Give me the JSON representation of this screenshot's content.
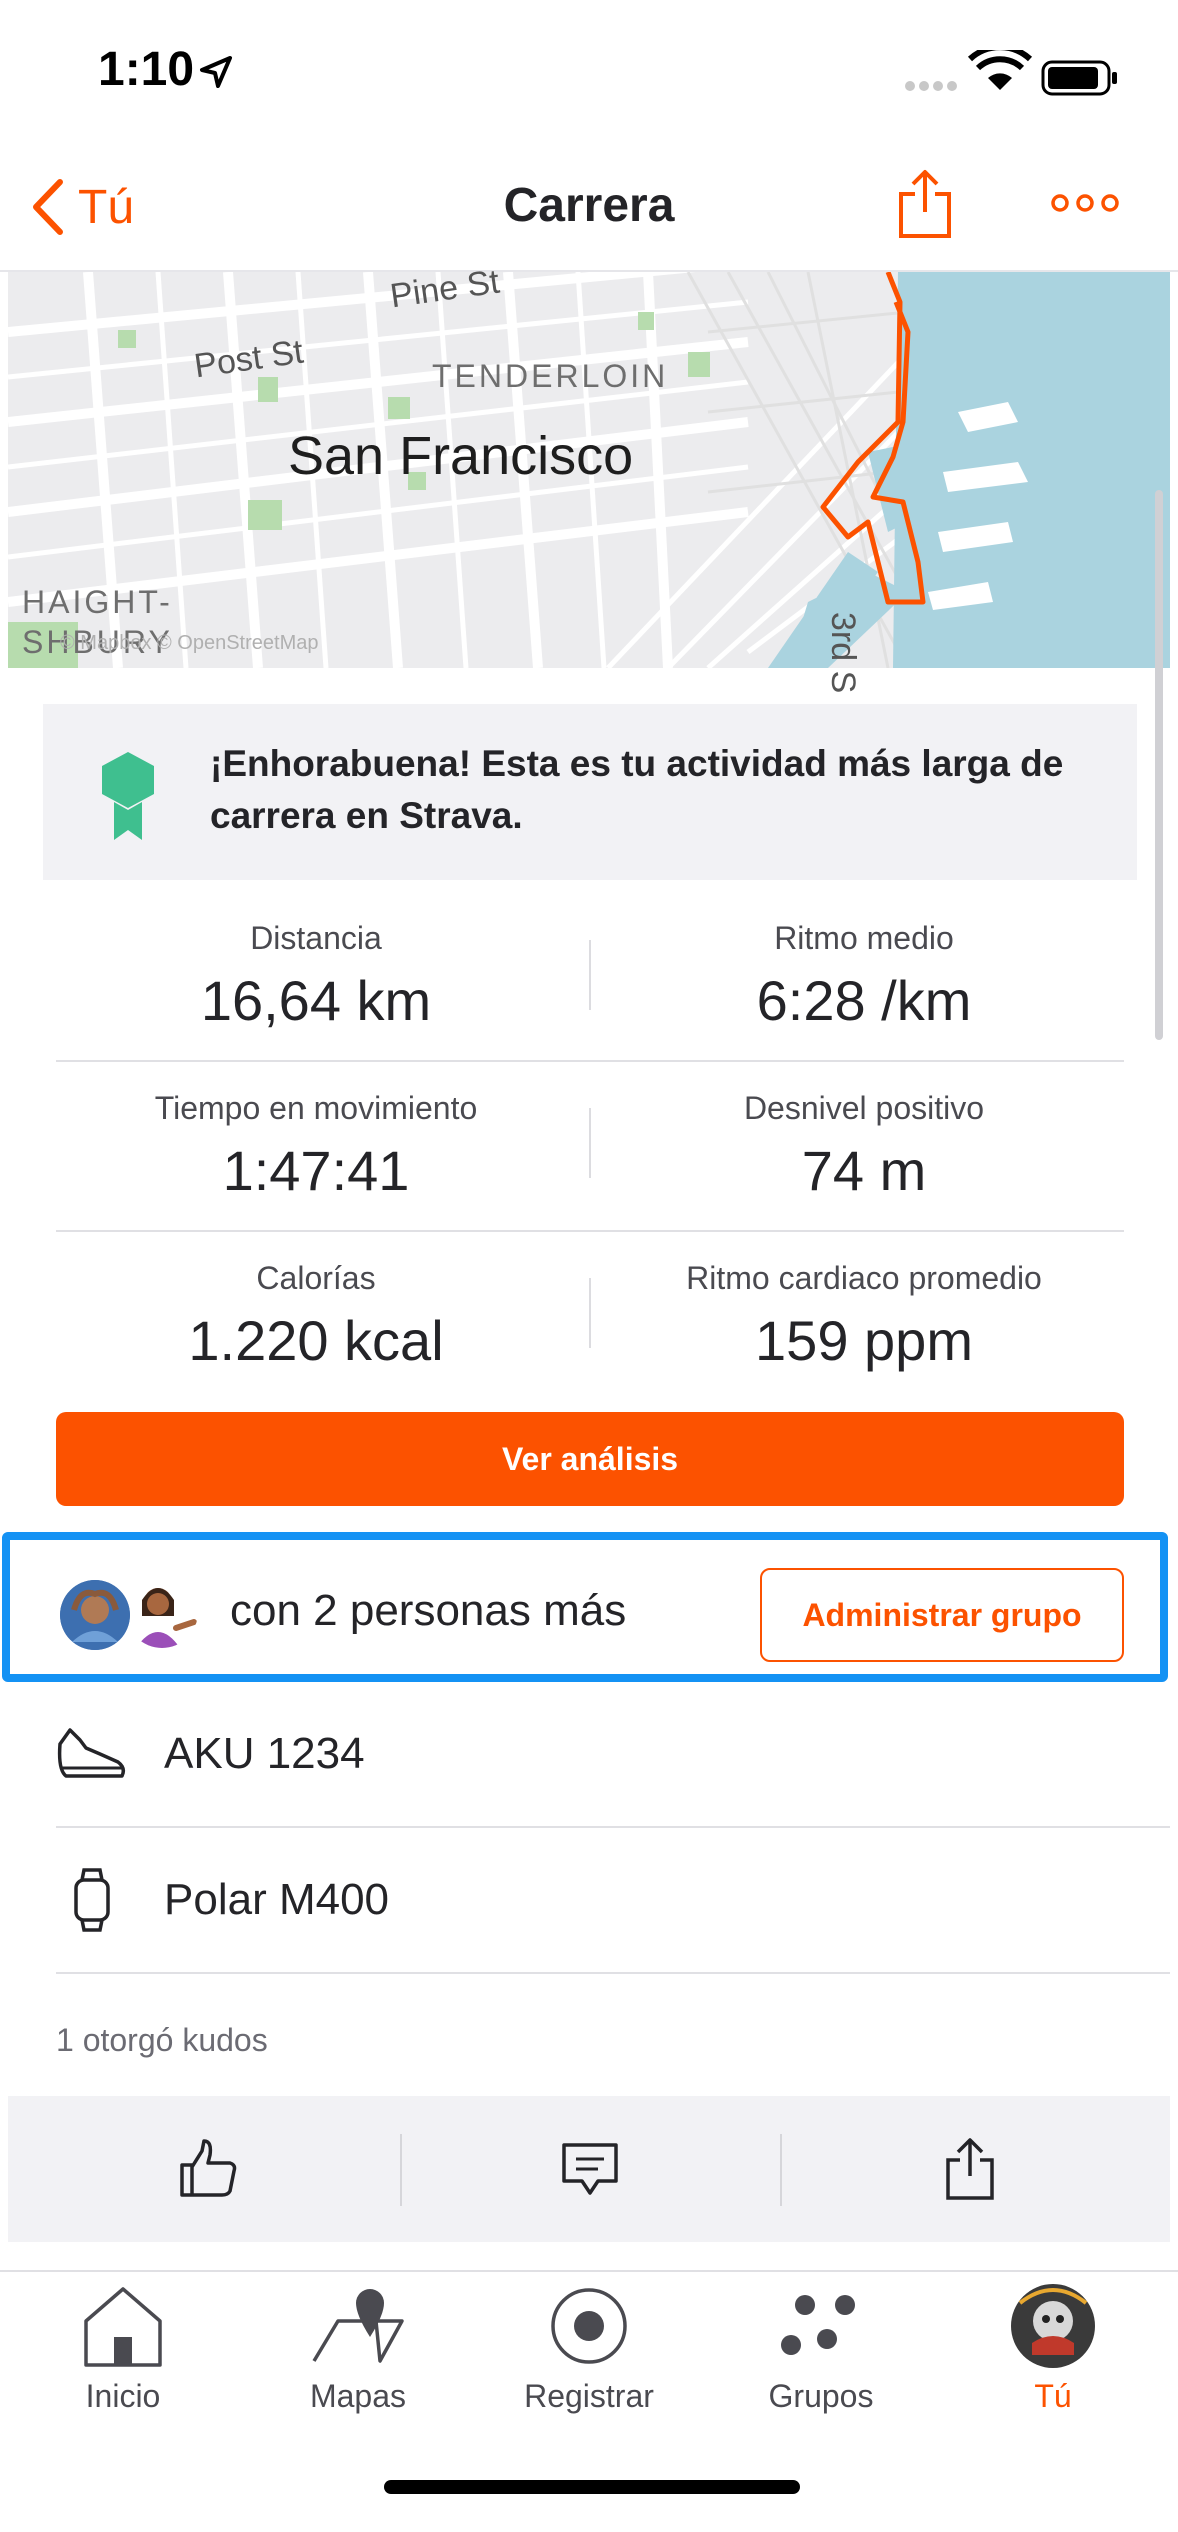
{
  "status_bar": {
    "time": "1:10"
  },
  "nav": {
    "back_label": "Tú",
    "title": "Carrera"
  },
  "map": {
    "city": "San Francisco",
    "district": "TENDERLOIN",
    "street_post": "Post St",
    "street_pine": "Pine St",
    "neighborhood_line1": "HAIGHT-",
    "neighborhood_line2": "SHBURY",
    "attribution": "© Mapbox © OpenStreetMap",
    "street_3rd": "3rd S"
  },
  "achievement": {
    "text": "¡Enhorabuena! Esta es tu actividad más larga de carrera en Strava."
  },
  "stats": [
    {
      "label": "Distancia",
      "value": "16,64 km"
    },
    {
      "label": "Ritmo medio",
      "value": "6:28 /km"
    },
    {
      "label": "Tiempo en movimiento",
      "value": "1:47:41"
    },
    {
      "label": "Desnivel positivo",
      "value": "74 m"
    },
    {
      "label": "Calorías",
      "value": "1.220 kcal"
    },
    {
      "label": "Ritmo cardiaco promedio",
      "value": "159 ppm"
    }
  ],
  "analysis_button": "Ver análisis",
  "group": {
    "text": "con 2 personas más",
    "button": "Administrar grupo"
  },
  "gear": [
    {
      "icon": "shoe-icon",
      "label": "AKU 1234"
    },
    {
      "icon": "watch-icon",
      "label": "Polar M400"
    }
  ],
  "kudos": "1 otorgó kudos",
  "actions": [
    "thumbs-up-icon",
    "comment-icon",
    "share-icon"
  ],
  "tabs": [
    {
      "label": "Inicio",
      "icon": "home-icon"
    },
    {
      "label": "Mapas",
      "icon": "map-icon"
    },
    {
      "label": "Registrar",
      "icon": "record-icon"
    },
    {
      "label": "Grupos",
      "icon": "groups-icon"
    },
    {
      "label": "Tú",
      "icon": "profile-avatar",
      "active": true
    }
  ],
  "colors": {
    "accent": "#fc5200",
    "highlight": "#1492f4",
    "route": "#fc5200",
    "water": "#aad3df"
  }
}
